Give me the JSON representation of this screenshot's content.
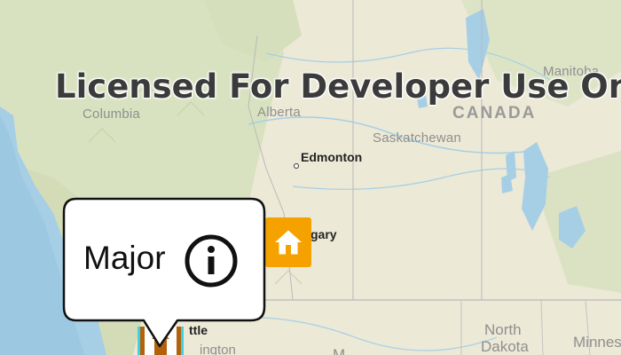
{
  "map": {
    "watermark": "Licensed For Developer Use Only",
    "labels": {
      "columbia": "Columbia",
      "alberta": "Alberta",
      "canada": "CANADA",
      "manitoba": "Manitoba",
      "saskatchewan": "Saskatchewan",
      "edmonton": "Edmonton",
      "calgary_partial": "gary",
      "seattle_partial": "ttle",
      "washington_partial": "ington",
      "north_dakota_1": "North",
      "north_dakota_2": "Dakota",
      "minnesota_partial": "Minnes",
      "montana_partial": "M"
    },
    "colors": {
      "land": "#ece9d6",
      "forest": "#d6e0bc",
      "water": "#a6cfe6",
      "marker_orange": "#f5a200",
      "marker_outline_cyan": "#3fd0e6",
      "marker_outline_brown": "#b3620b"
    }
  },
  "callout": {
    "title": "Major",
    "icon": "info-icon"
  },
  "markers": {
    "home": {
      "icon": "home-icon"
    },
    "selected": {
      "icon": "home-icon"
    }
  }
}
